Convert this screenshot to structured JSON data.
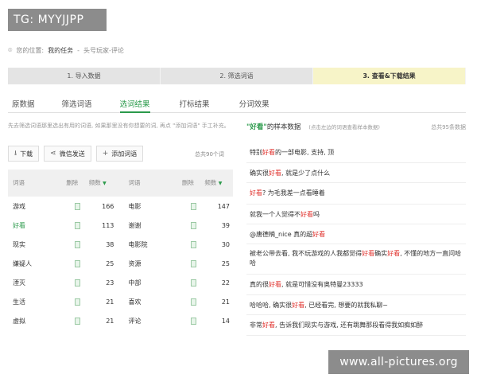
{
  "watermark_top": "TG: MYYJJPP",
  "watermark_bottom": "www.all-pictures.org",
  "breadcrumb": {
    "prefix": "您的位置:",
    "current": "我的任务",
    "separator": "-",
    "task": "头号玩家-评论"
  },
  "steps": [
    "1. 导入数据",
    "2. 筛选词语",
    "3. 查看&下载结果"
  ],
  "active_step": 2,
  "tabs": [
    "原数据",
    "筛选词语",
    "选词结果",
    "打标结果",
    "分词效果"
  ],
  "active_tab": 2,
  "hint": "先去筛选词语那里选出有用的词语, 如果那里没有你想要的词, 再点 \"添加词语\" 手工补充。",
  "toolbar": {
    "download": "下载",
    "wechat": "微信发送",
    "add_word": "添加词语",
    "total": "总共90个词"
  },
  "table": {
    "headers": {
      "word": "词语",
      "delete": "删除",
      "frequency": "频数"
    },
    "left_rows": [
      {
        "word": "游戏",
        "count": "166"
      },
      {
        "word": "好看",
        "count": "113"
      },
      {
        "word": "现实",
        "count": "38"
      },
      {
        "word": "嫌疑人",
        "count": "25"
      },
      {
        "word": "湮灭",
        "count": "23"
      },
      {
        "word": "生活",
        "count": "21"
      },
      {
        "word": "虚拟",
        "count": "21"
      }
    ],
    "right_rows": [
      {
        "word": "电影",
        "count": "147"
      },
      {
        "word": "谢谢",
        "count": "39"
      },
      {
        "word": "电影院",
        "count": "30"
      },
      {
        "word": "资源",
        "count": "25"
      },
      {
        "word": "中部",
        "count": "22"
      },
      {
        "word": "喜欢",
        "count": "21"
      },
      {
        "word": "评论",
        "count": "14"
      }
    ],
    "highlight_word": "好看"
  },
  "samples_panel": {
    "keyword": "\"好看\"",
    "title_suffix": "的样本数据",
    "subtitle": "(点击左边的词语查看样本数据)",
    "total": "总共95条数据",
    "samples": [
      [
        {
          "t": "特别"
        },
        {
          "t": "好看",
          "kw": true
        },
        {
          "t": "的一部电影, 支持, 顶"
        }
      ],
      [
        {
          "t": "确实很"
        },
        {
          "t": "好看",
          "kw": true
        },
        {
          "t": ", 就是少了点什么"
        }
      ],
      [
        {
          "t": "好看",
          "kw": true
        },
        {
          "t": "? 为毛我差一点看睡着"
        }
      ],
      [
        {
          "t": "就我一个人觉得不"
        },
        {
          "t": "好看",
          "kw": true
        },
        {
          "t": "吗"
        }
      ],
      [
        {
          "t": "@唐德楠_nice  真的超"
        },
        {
          "t": "好看",
          "kw": true
        }
      ],
      [
        {
          "t": "被老公带去看, 我不玩游戏的人我都觉得"
        },
        {
          "t": "好看",
          "kw": true
        },
        {
          "t": "确实"
        },
        {
          "t": "好看",
          "kw": true
        },
        {
          "t": ", 不懂的地方一直问哈哈"
        }
      ],
      [
        {
          "t": "真的很"
        },
        {
          "t": "好看",
          "kw": true
        },
        {
          "t": ", 就是可惜没有奥特曼23333"
        }
      ],
      [
        {
          "t": "哈哈哈, 确实很"
        },
        {
          "t": "好看",
          "kw": true
        },
        {
          "t": ", 已经看完, 想要的就我私聊~"
        }
      ],
      [
        {
          "t": "非常"
        },
        {
          "t": "好看",
          "kw": true
        },
        {
          "t": ", 告诉我们现实与游戏, 还有跳舞那段看得我如痴如醉"
        }
      ]
    ]
  },
  "colors": {
    "accent": "#2b9a4b",
    "keyword": "#e0312c",
    "active_step_bg": "#f7f4c8"
  }
}
